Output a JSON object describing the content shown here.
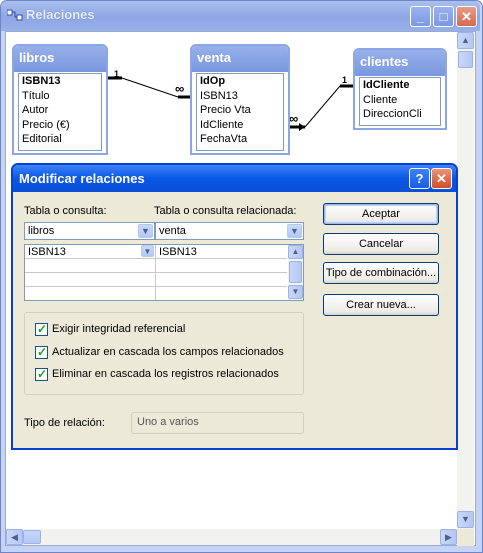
{
  "window": {
    "title": "Relaciones"
  },
  "tables": [
    {
      "name": "libros",
      "fields": [
        "ISBN13",
        "Título",
        "Autor",
        "Precio (€)",
        "Editorial"
      ],
      "primary_key": "ISBN13"
    },
    {
      "name": "venta",
      "fields": [
        "IdOp",
        "ISBN13",
        "Precio Vta",
        "IdCliente",
        "FechaVta"
      ],
      "primary_key": "IdOp"
    },
    {
      "name": "clientes",
      "fields": [
        "IdCliente",
        "Cliente",
        "DireccionCli"
      ],
      "primary_key": "IdCliente"
    }
  ],
  "relationships": [
    {
      "one_label": "1",
      "many_label": "∞"
    },
    {
      "one_label": "1",
      "many_label": "∞"
    }
  ],
  "dialog": {
    "title": "Modificar relaciones",
    "table_label": "Tabla o consulta:",
    "related_label": "Tabla o consulta relacionada:",
    "table_value": "libros",
    "related_value": "venta",
    "field_rows": [
      {
        "left": "ISBN13",
        "right": "ISBN13"
      },
      {
        "left": "",
        "right": ""
      },
      {
        "left": "",
        "right": ""
      },
      {
        "left": "",
        "right": ""
      }
    ],
    "buttons": {
      "accept": "Aceptar",
      "cancel": "Cancelar",
      "join_type": "Tipo de combinación...",
      "create_new": "Crear nueva..."
    },
    "options": [
      {
        "label": "Exigir integridad referencial",
        "checked": true
      },
      {
        "label": "Actualizar en cascada los campos relacionados",
        "checked": true
      },
      {
        "label": "Eliminar en cascada los registros relacionados",
        "checked": true
      }
    ],
    "relation_type_label": "Tipo de relación:",
    "relation_type_value": "Uno a varios"
  },
  "icons": {
    "window": "relationships-icon",
    "help": "help-icon",
    "close": "close-icon",
    "minimize": "minimize-icon",
    "maximize": "maximize-icon",
    "dropdown": "chevron-down-icon"
  }
}
